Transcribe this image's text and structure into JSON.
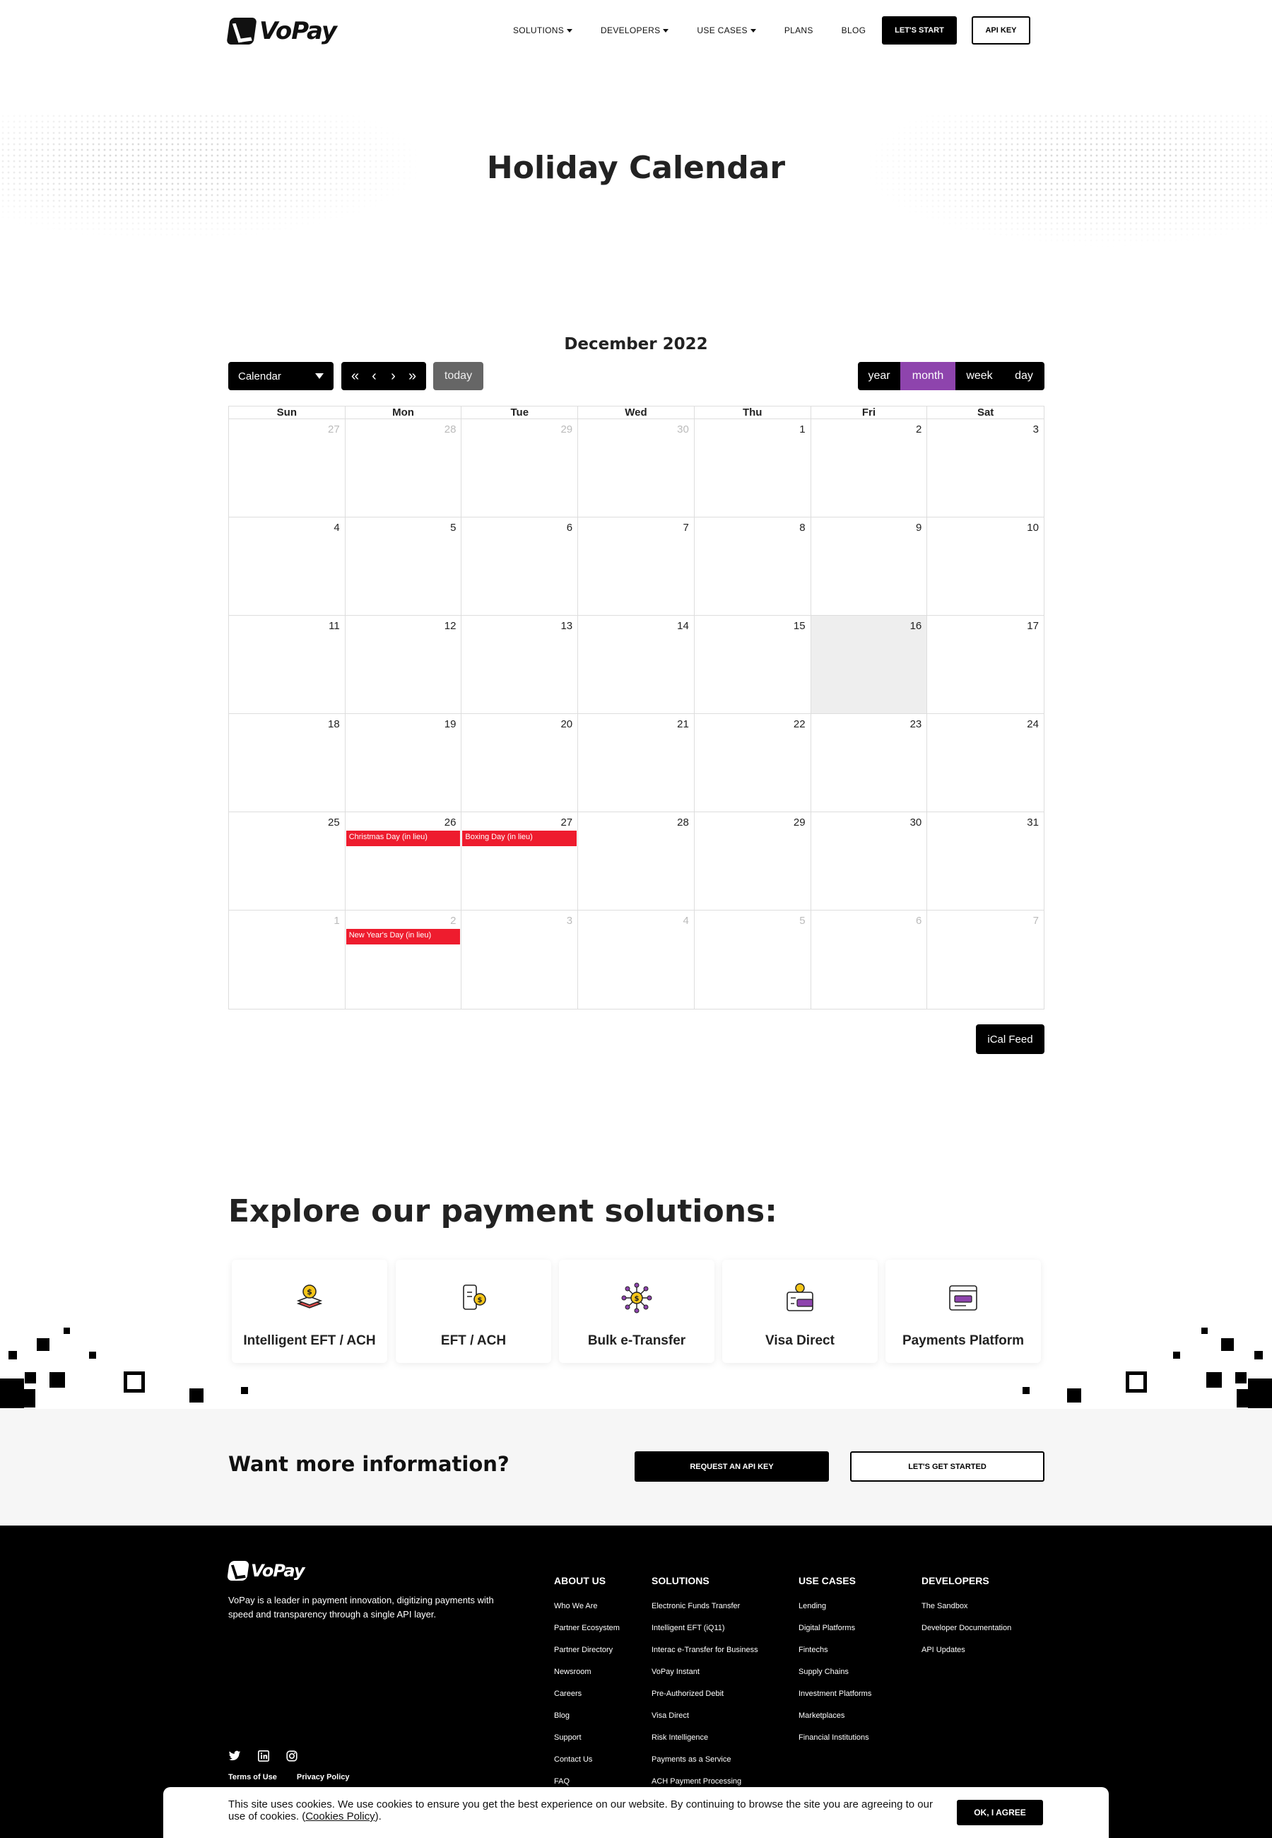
{
  "header": {
    "logo_text": "VoPay",
    "nav": [
      {
        "label": "SOLUTIONS",
        "dropdown": true
      },
      {
        "label": "DEVELOPERS",
        "dropdown": true
      },
      {
        "label": "USE CASES",
        "dropdown": true
      },
      {
        "label": "PLANS",
        "dropdown": false
      },
      {
        "label": "BLOG",
        "dropdown": false
      }
    ],
    "start_label": "LET'S START",
    "api_label": "API KEY"
  },
  "hero": {
    "title": "Holiday Calendar"
  },
  "calendar": {
    "title": "December 2022",
    "select_value": "Calendar",
    "today_label": "today",
    "views": [
      {
        "label": "year",
        "active": false
      },
      {
        "label": "month",
        "active": true
      },
      {
        "label": "week",
        "active": false
      },
      {
        "label": "day",
        "active": false
      }
    ],
    "day_names": [
      "Sun",
      "Mon",
      "Tue",
      "Wed",
      "Thu",
      "Fri",
      "Sat"
    ],
    "weeks": [
      [
        {
          "n": "27",
          "other": true
        },
        {
          "n": "28",
          "other": true
        },
        {
          "n": "29",
          "other": true
        },
        {
          "n": "30",
          "other": true
        },
        {
          "n": "1"
        },
        {
          "n": "2"
        },
        {
          "n": "3"
        }
      ],
      [
        {
          "n": "4"
        },
        {
          "n": "5"
        },
        {
          "n": "6"
        },
        {
          "n": "7"
        },
        {
          "n": "8"
        },
        {
          "n": "9"
        },
        {
          "n": "10"
        }
      ],
      [
        {
          "n": "11"
        },
        {
          "n": "12"
        },
        {
          "n": "13"
        },
        {
          "n": "14"
        },
        {
          "n": "15"
        },
        {
          "n": "16",
          "today": true
        },
        {
          "n": "17"
        }
      ],
      [
        {
          "n": "18"
        },
        {
          "n": "19"
        },
        {
          "n": "20"
        },
        {
          "n": "21"
        },
        {
          "n": "22"
        },
        {
          "n": "23"
        },
        {
          "n": "24"
        }
      ],
      [
        {
          "n": "25"
        },
        {
          "n": "26",
          "event": "Christmas Day (in lieu)"
        },
        {
          "n": "27",
          "event": "Boxing Day (in lieu)"
        },
        {
          "n": "28"
        },
        {
          "n": "29"
        },
        {
          "n": "30"
        },
        {
          "n": "31"
        }
      ],
      [
        {
          "n": "1",
          "other": true
        },
        {
          "n": "2",
          "other": true,
          "event": "New Year's Day (in lieu)"
        },
        {
          "n": "3",
          "other": true
        },
        {
          "n": "4",
          "other": true
        },
        {
          "n": "5",
          "other": true
        },
        {
          "n": "6",
          "other": true
        },
        {
          "n": "7",
          "other": true
        }
      ]
    ],
    "event_color": "#ee1c2e",
    "active_view_color": "#8e44ad",
    "ical_label": "iCal Feed"
  },
  "explore": {
    "title": "Explore our payment solutions:",
    "solutions": [
      {
        "label": "Intelligent EFT / ACH",
        "icon": "coin-stack-icon"
      },
      {
        "label": "EFT / ACH",
        "icon": "mobile-payment-icon"
      },
      {
        "label": "Bulk e-Transfer",
        "icon": "network-coin-icon"
      },
      {
        "label": "Visa Direct",
        "icon": "card-wallet-icon"
      },
      {
        "label": "Payments Platform",
        "icon": "browser-window-icon"
      }
    ]
  },
  "info": {
    "title": "Want more information?",
    "request_label": "REQUEST AN API KEY",
    "started_label": "LET'S GET STARTED"
  },
  "footer": {
    "logo_text": "VoPay",
    "description": "VoPay is a leader in payment innovation, digitizing payments with speed and transparency through a single API layer.",
    "columns": [
      {
        "title": "ABOUT US",
        "items": [
          "Who We Are",
          "Partner Ecosystem",
          "Partner Directory",
          "Newsroom",
          "Careers",
          "Blog",
          "Support",
          "Contact Us",
          "FAQ"
        ]
      },
      {
        "title": "SOLUTIONS",
        "items": [
          "Electronic Funds Transfer",
          "Intelligent EFT (iQ11)",
          "Interac e-Transfer for Business",
          "VoPay Instant",
          "Pre-Authorized Debit",
          "Visa Direct",
          "Risk Intelligence",
          "Payments as a Service",
          "ACH Payment Processing"
        ]
      },
      {
        "title": "USE CASES",
        "items": [
          "Lending",
          "Digital Platforms",
          "Fintechs",
          "Supply Chains",
          "Investment Platforms",
          "Marketplaces",
          "Financial Institutions"
        ]
      },
      {
        "title": "DEVELOPERS",
        "items": [
          "The Sandbox",
          "Developer Documentation",
          "API Updates"
        ]
      }
    ],
    "social": [
      "twitter-icon",
      "linkedin-icon",
      "instagram-icon"
    ],
    "terms_label": "Terms of Use",
    "privacy_label": "Privacy Policy"
  },
  "cookie": {
    "text": "This site uses cookies. We use cookies to ensure you get the best experience on our website. By continuing to browse the site you are agreeing to our use of cookies. (",
    "link": "Cookies Policy",
    "text_end": ").",
    "ok_label": "OK, I AGREE"
  }
}
